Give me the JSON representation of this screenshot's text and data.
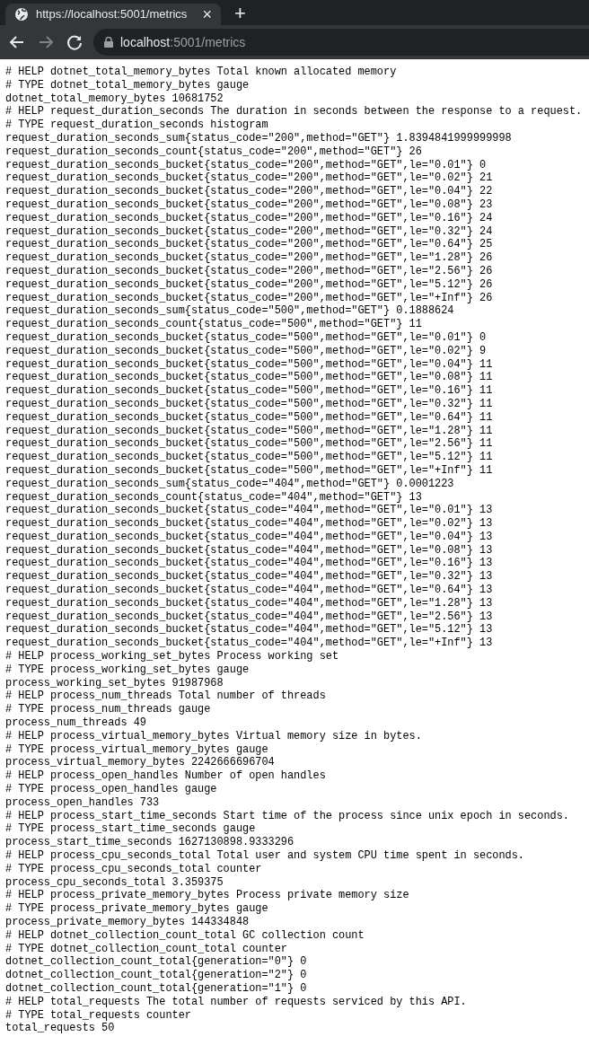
{
  "tab": {
    "title": "https://localhost:5001/metrics",
    "selected": true,
    "close": "×",
    "new_tab": "+"
  },
  "address": {
    "host": "localhost",
    "rest": ":5001/metrics"
  },
  "lines": [
    "# HELP dotnet_total_memory_bytes Total known allocated memory",
    "# TYPE dotnet_total_memory_bytes gauge",
    "dotnet_total_memory_bytes 10681752",
    "# HELP request_duration_seconds The duration in seconds between the response to a request.",
    "# TYPE request_duration_seconds histogram",
    "request_duration_seconds_sum{status_code=\"200\",method=\"GET\"} 1.8394841999999998",
    "request_duration_seconds_count{status_code=\"200\",method=\"GET\"} 26",
    "request_duration_seconds_bucket{status_code=\"200\",method=\"GET\",le=\"0.01\"} 0",
    "request_duration_seconds_bucket{status_code=\"200\",method=\"GET\",le=\"0.02\"} 21",
    "request_duration_seconds_bucket{status_code=\"200\",method=\"GET\",le=\"0.04\"} 22",
    "request_duration_seconds_bucket{status_code=\"200\",method=\"GET\",le=\"0.08\"} 23",
    "request_duration_seconds_bucket{status_code=\"200\",method=\"GET\",le=\"0.16\"} 24",
    "request_duration_seconds_bucket{status_code=\"200\",method=\"GET\",le=\"0.32\"} 24",
    "request_duration_seconds_bucket{status_code=\"200\",method=\"GET\",le=\"0.64\"} 25",
    "request_duration_seconds_bucket{status_code=\"200\",method=\"GET\",le=\"1.28\"} 26",
    "request_duration_seconds_bucket{status_code=\"200\",method=\"GET\",le=\"2.56\"} 26",
    "request_duration_seconds_bucket{status_code=\"200\",method=\"GET\",le=\"5.12\"} 26",
    "request_duration_seconds_bucket{status_code=\"200\",method=\"GET\",le=\"+Inf\"} 26",
    "request_duration_seconds_sum{status_code=\"500\",method=\"GET\"} 0.1888624",
    "request_duration_seconds_count{status_code=\"500\",method=\"GET\"} 11",
    "request_duration_seconds_bucket{status_code=\"500\",method=\"GET\",le=\"0.01\"} 0",
    "request_duration_seconds_bucket{status_code=\"500\",method=\"GET\",le=\"0.02\"} 9",
    "request_duration_seconds_bucket{status_code=\"500\",method=\"GET\",le=\"0.04\"} 11",
    "request_duration_seconds_bucket{status_code=\"500\",method=\"GET\",le=\"0.08\"} 11",
    "request_duration_seconds_bucket{status_code=\"500\",method=\"GET\",le=\"0.16\"} 11",
    "request_duration_seconds_bucket{status_code=\"500\",method=\"GET\",le=\"0.32\"} 11",
    "request_duration_seconds_bucket{status_code=\"500\",method=\"GET\",le=\"0.64\"} 11",
    "request_duration_seconds_bucket{status_code=\"500\",method=\"GET\",le=\"1.28\"} 11",
    "request_duration_seconds_bucket{status_code=\"500\",method=\"GET\",le=\"2.56\"} 11",
    "request_duration_seconds_bucket{status_code=\"500\",method=\"GET\",le=\"5.12\"} 11",
    "request_duration_seconds_bucket{status_code=\"500\",method=\"GET\",le=\"+Inf\"} 11",
    "request_duration_seconds_sum{status_code=\"404\",method=\"GET\"} 0.0001223",
    "request_duration_seconds_count{status_code=\"404\",method=\"GET\"} 13",
    "request_duration_seconds_bucket{status_code=\"404\",method=\"GET\",le=\"0.01\"} 13",
    "request_duration_seconds_bucket{status_code=\"404\",method=\"GET\",le=\"0.02\"} 13",
    "request_duration_seconds_bucket{status_code=\"404\",method=\"GET\",le=\"0.04\"} 13",
    "request_duration_seconds_bucket{status_code=\"404\",method=\"GET\",le=\"0.08\"} 13",
    "request_duration_seconds_bucket{status_code=\"404\",method=\"GET\",le=\"0.16\"} 13",
    "request_duration_seconds_bucket{status_code=\"404\",method=\"GET\",le=\"0.32\"} 13",
    "request_duration_seconds_bucket{status_code=\"404\",method=\"GET\",le=\"0.64\"} 13",
    "request_duration_seconds_bucket{status_code=\"404\",method=\"GET\",le=\"1.28\"} 13",
    "request_duration_seconds_bucket{status_code=\"404\",method=\"GET\",le=\"2.56\"} 13",
    "request_duration_seconds_bucket{status_code=\"404\",method=\"GET\",le=\"5.12\"} 13",
    "request_duration_seconds_bucket{status_code=\"404\",method=\"GET\",le=\"+Inf\"} 13",
    "# HELP process_working_set_bytes Process working set",
    "# TYPE process_working_set_bytes gauge",
    "process_working_set_bytes 91987968",
    "# HELP process_num_threads Total number of threads",
    "# TYPE process_num_threads gauge",
    "process_num_threads 49",
    "# HELP process_virtual_memory_bytes Virtual memory size in bytes.",
    "# TYPE process_virtual_memory_bytes gauge",
    "process_virtual_memory_bytes 2242666696704",
    "# HELP process_open_handles Number of open handles",
    "# TYPE process_open_handles gauge",
    "process_open_handles 733",
    "# HELP process_start_time_seconds Start time of the process since unix epoch in seconds.",
    "# TYPE process_start_time_seconds gauge",
    "process_start_time_seconds 1627130898.9333296",
    "# HELP process_cpu_seconds_total Total user and system CPU time spent in seconds.",
    "# TYPE process_cpu_seconds_total counter",
    "process_cpu_seconds_total 3.359375",
    "# HELP process_private_memory_bytes Process private memory size",
    "# TYPE process_private_memory_bytes gauge",
    "process_private_memory_bytes 144334848",
    "# HELP dotnet_collection_count_total GC collection count",
    "# TYPE dotnet_collection_count_total counter",
    "dotnet_collection_count_total{generation=\"0\"} 0",
    "dotnet_collection_count_total{generation=\"2\"} 0",
    "dotnet_collection_count_total{generation=\"1\"} 0",
    "# HELP total_requests The total number of requests serviced by this API.",
    "# TYPE total_requests counter",
    "total_requests 50"
  ]
}
